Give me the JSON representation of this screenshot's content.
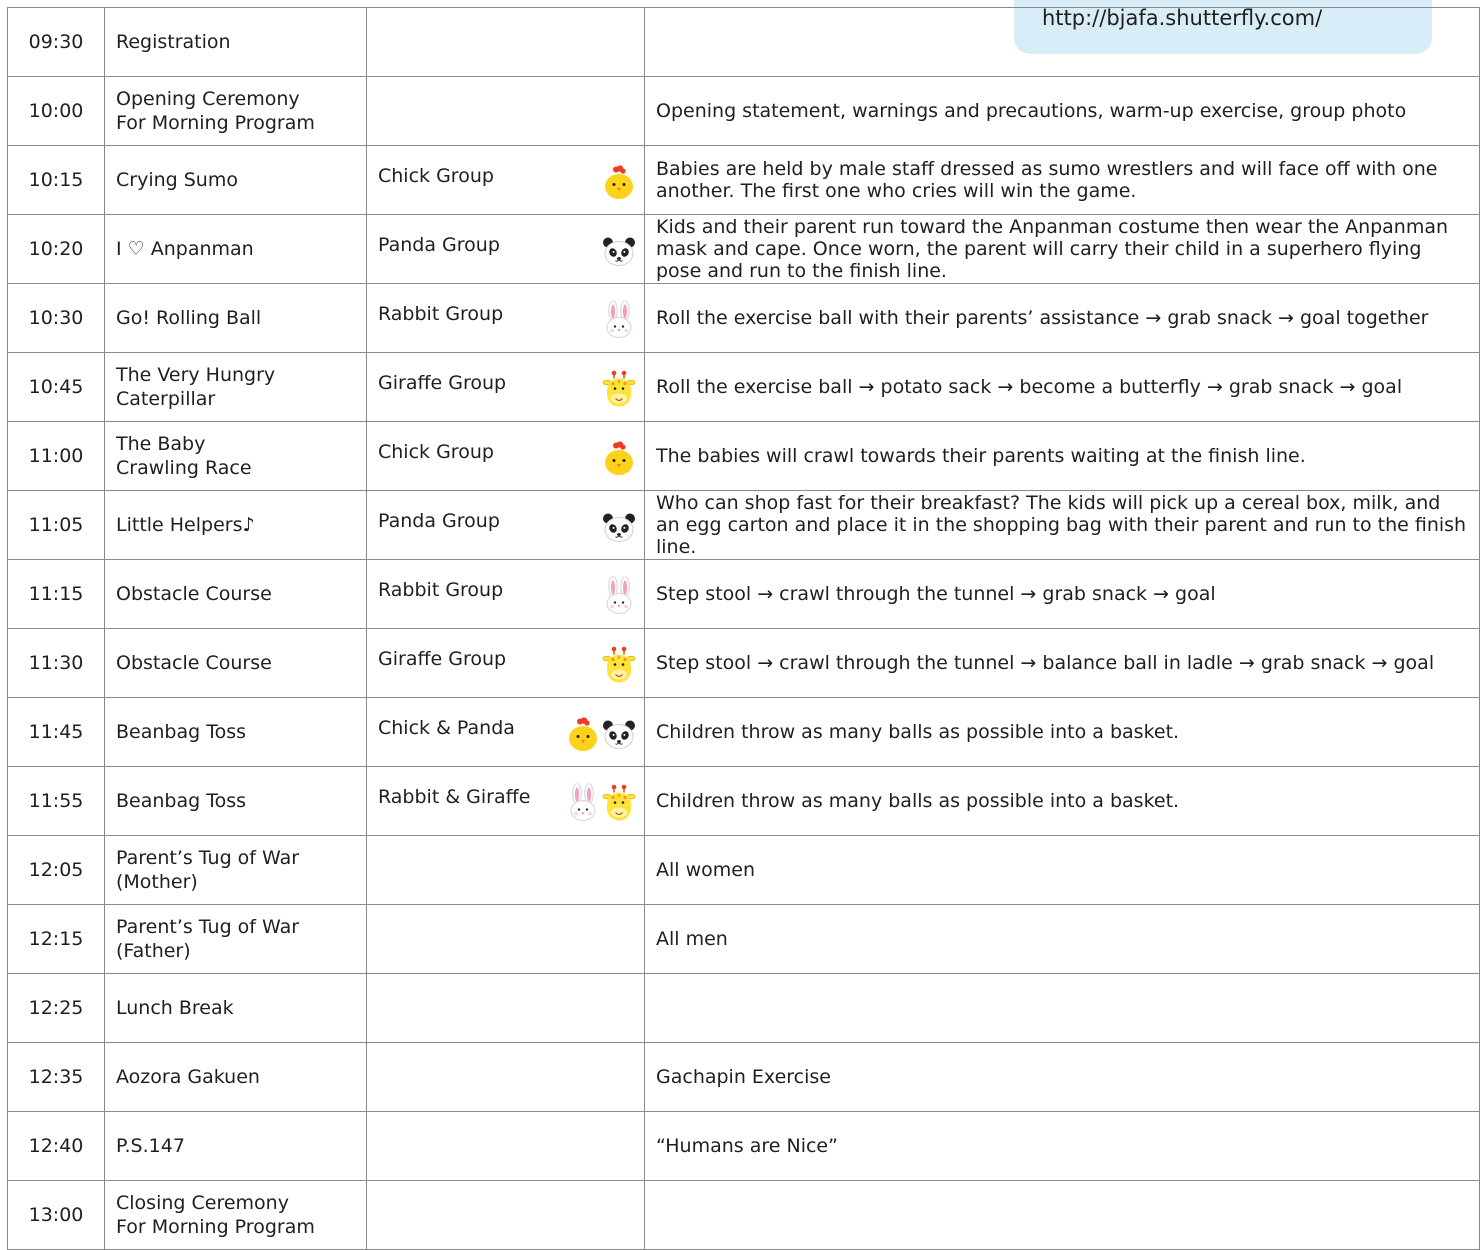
{
  "banner": {
    "url": "http://bjafa.shutterfly.com/"
  },
  "rows": [
    {
      "time": "09:30",
      "event": [
        "Registration"
      ],
      "group": "",
      "icons": [],
      "desc": ""
    },
    {
      "time": "10:00",
      "event": [
        "Opening Ceremony",
        "For Morning Program"
      ],
      "group": "",
      "icons": [],
      "desc": "Opening statement, warnings and precautions, warm-up exercise, group photo"
    },
    {
      "time": "10:15",
      "event": [
        "Crying Sumo"
      ],
      "group": "Chick Group",
      "icons": [
        "chick-icon"
      ],
      "desc": "Babies are held by male staff dressed as sumo wrestlers and will face off with one another. The first one who cries will win the game."
    },
    {
      "time": "10:20",
      "event": [
        "I ♡ Anpanman"
      ],
      "group": "Panda Group",
      "icons": [
        "panda-icon"
      ],
      "desc": "Kids and their parent run toward the Anpanman costume then wear the Anpanman mask and cape. Once worn, the parent will carry their child in a superhero flying pose and run to the finish line."
    },
    {
      "time": "10:30",
      "event": [
        "Go! Rolling Ball"
      ],
      "group": "Rabbit Group",
      "icons": [
        "rabbit-icon"
      ],
      "desc": "Roll the exercise ball with their parents’ assistance → grab snack → goal together"
    },
    {
      "time": "10:45",
      "event": [
        "The Very Hungry",
        "Caterpillar"
      ],
      "group": "Giraffe Group",
      "icons": [
        "giraffe-icon"
      ],
      "desc": "Roll the exercise ball → potato sack → become a butterfly → grab snack → goal"
    },
    {
      "time": "11:00",
      "event": [
        "The Baby",
        "Crawling Race"
      ],
      "group": "Chick Group",
      "icons": [
        "chick-icon"
      ],
      "desc": "The babies will crawl towards their parents waiting at the finish line."
    },
    {
      "time": "11:05",
      "event": [
        "Little Helpers♪"
      ],
      "group": "Panda Group",
      "icons": [
        "panda-icon"
      ],
      "desc": "Who can shop fast for their breakfast? The kids will pick up a cereal box, milk, and an egg carton and place it in the shopping bag with their parent and run to the finish line."
    },
    {
      "time": "11:15",
      "event": [
        "Obstacle Course"
      ],
      "group": "Rabbit Group",
      "icons": [
        "rabbit-icon"
      ],
      "desc": "Step stool → crawl through the tunnel → grab snack → goal"
    },
    {
      "time": "11:30",
      "event": [
        "Obstacle Course"
      ],
      "group": "Giraffe Group",
      "icons": [
        "giraffe-icon"
      ],
      "desc": "Step stool → crawl through the tunnel → balance ball in ladle → grab snack → goal"
    },
    {
      "time": "11:45",
      "event": [
        "Beanbag Toss"
      ],
      "group": "Chick & Panda",
      "icons": [
        "chick-icon",
        "panda-icon"
      ],
      "desc": "Children throw as many balls as possible into a basket."
    },
    {
      "time": "11:55",
      "event": [
        "Beanbag Toss"
      ],
      "group": "Rabbit & Giraffe",
      "icons": [
        "rabbit-icon",
        "giraffe-icon"
      ],
      "desc": "Children throw as many balls as possible into a basket."
    },
    {
      "time": "12:05",
      "event": [
        "Parent’s Tug of War",
        "(Mother)"
      ],
      "group": "",
      "icons": [],
      "desc": "All women"
    },
    {
      "time": "12:15",
      "event": [
        "Parent’s Tug of War",
        "(Father)"
      ],
      "group": "",
      "icons": [],
      "desc": "All men"
    },
    {
      "time": "12:25",
      "event": [
        "Lunch Break"
      ],
      "group": "",
      "icons": [],
      "desc": ""
    },
    {
      "time": "12:35",
      "event": [
        "Aozora Gakuen"
      ],
      "group": "",
      "icons": [],
      "desc": "Gachapin Exercise"
    },
    {
      "time": "12:40",
      "event": [
        "P.S.147"
      ],
      "group": "",
      "icons": [],
      "desc": "“Humans are Nice”"
    },
    {
      "time": "13:00",
      "event": [
        "Closing Ceremony",
        "For Morning Program"
      ],
      "group": "",
      "icons": [],
      "desc": ""
    }
  ],
  "colors": {
    "banner_bg": "#d8edf7",
    "border": "#8a8a8a",
    "chick_yellow": "#ffd21a",
    "giraffe_yellow": "#ffe23a",
    "comb_red": "#ee3b24",
    "rabbit_pink": "#f4a0c4"
  }
}
